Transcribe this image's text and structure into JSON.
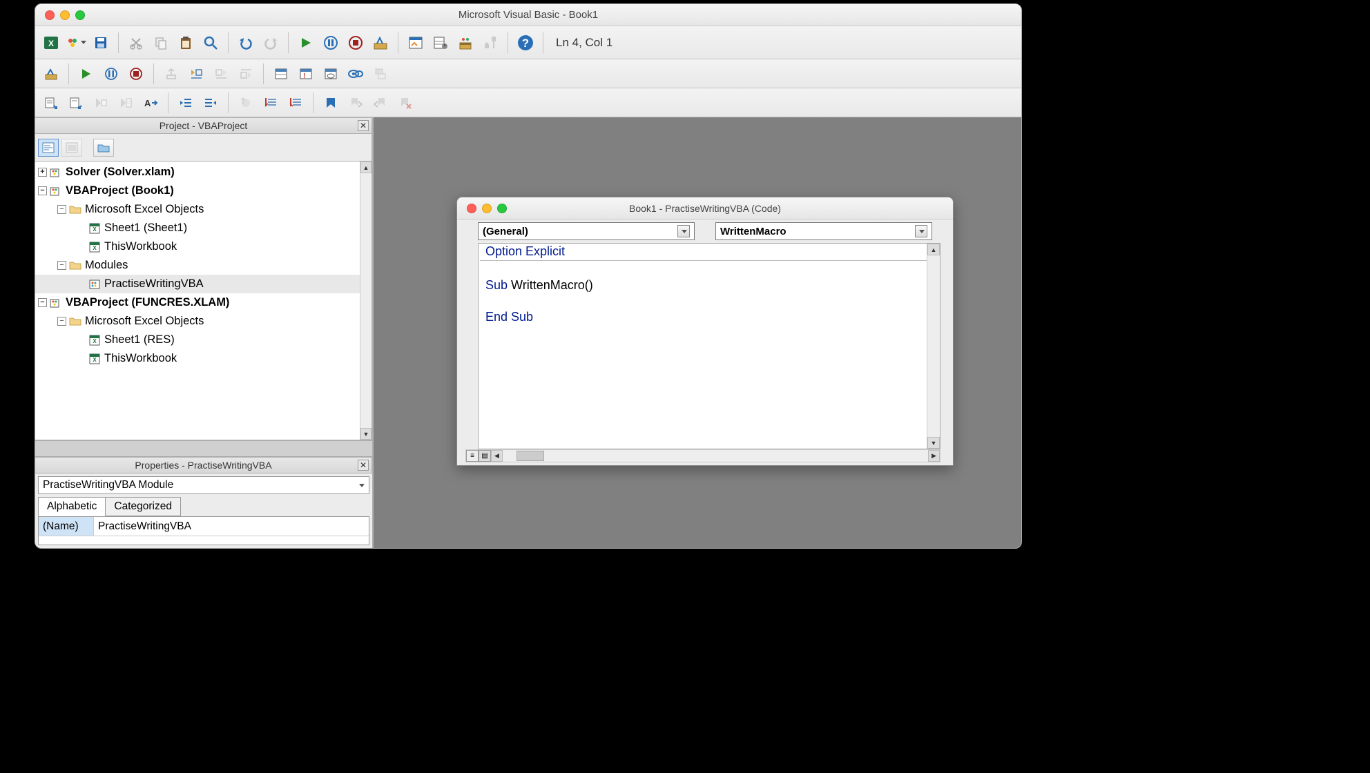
{
  "window": {
    "title": "Microsoft Visual Basic - Book1"
  },
  "status": {
    "cursor": "Ln 4, Col 1"
  },
  "project_panel": {
    "title": "Project - VBAProject",
    "tree": [
      {
        "label": "Solver (Solver.xlam)",
        "bold": true,
        "depth": 0,
        "exp": "+",
        "icon": "vba"
      },
      {
        "label": "VBAProject (Book1)",
        "bold": true,
        "depth": 0,
        "exp": "−",
        "icon": "vba"
      },
      {
        "label": "Microsoft Excel Objects",
        "bold": false,
        "depth": 1,
        "exp": "−",
        "icon": "folder"
      },
      {
        "label": "Sheet1 (Sheet1)",
        "bold": false,
        "depth": 2,
        "exp": "",
        "icon": "sheet"
      },
      {
        "label": "ThisWorkbook",
        "bold": false,
        "depth": 2,
        "exp": "",
        "icon": "sheet"
      },
      {
        "label": "Modules",
        "bold": false,
        "depth": 1,
        "exp": "−",
        "icon": "folder"
      },
      {
        "label": "PractiseWritingVBA",
        "bold": false,
        "depth": 2,
        "exp": "",
        "icon": "module",
        "selected": true
      },
      {
        "label": "VBAProject (FUNCRES.XLAM)",
        "bold": true,
        "depth": 0,
        "exp": "−",
        "icon": "vba"
      },
      {
        "label": "Microsoft Excel Objects",
        "bold": false,
        "depth": 1,
        "exp": "−",
        "icon": "folder"
      },
      {
        "label": "Sheet1 (RES)",
        "bold": false,
        "depth": 2,
        "exp": "",
        "icon": "sheet"
      },
      {
        "label": "ThisWorkbook",
        "bold": false,
        "depth": 2,
        "exp": "",
        "icon": "sheet"
      }
    ]
  },
  "properties_panel": {
    "title": "Properties - PractiseWritingVBA",
    "combo": "PractiseWritingVBA  Module",
    "tabs": {
      "alpha": "Alphabetic",
      "cat": "Categorized"
    },
    "rows": [
      {
        "name": "(Name)",
        "value": "PractiseWritingVBA"
      }
    ]
  },
  "code_window": {
    "title": "Book1 - PractiseWritingVBA (Code)",
    "object_dd": "(General)",
    "proc_dd": "WrittenMacro",
    "lines": [
      {
        "t": "Option Explicit",
        "kw_full": true
      },
      {
        "hr": true
      },
      {
        "t": "",
        "blank": true
      },
      {
        "pre": "Sub ",
        "mid": "WrittenMacro()",
        "kw_pre": true
      },
      {
        "t": ""
      },
      {
        "t": "End Sub",
        "kw_full": true
      }
    ]
  }
}
